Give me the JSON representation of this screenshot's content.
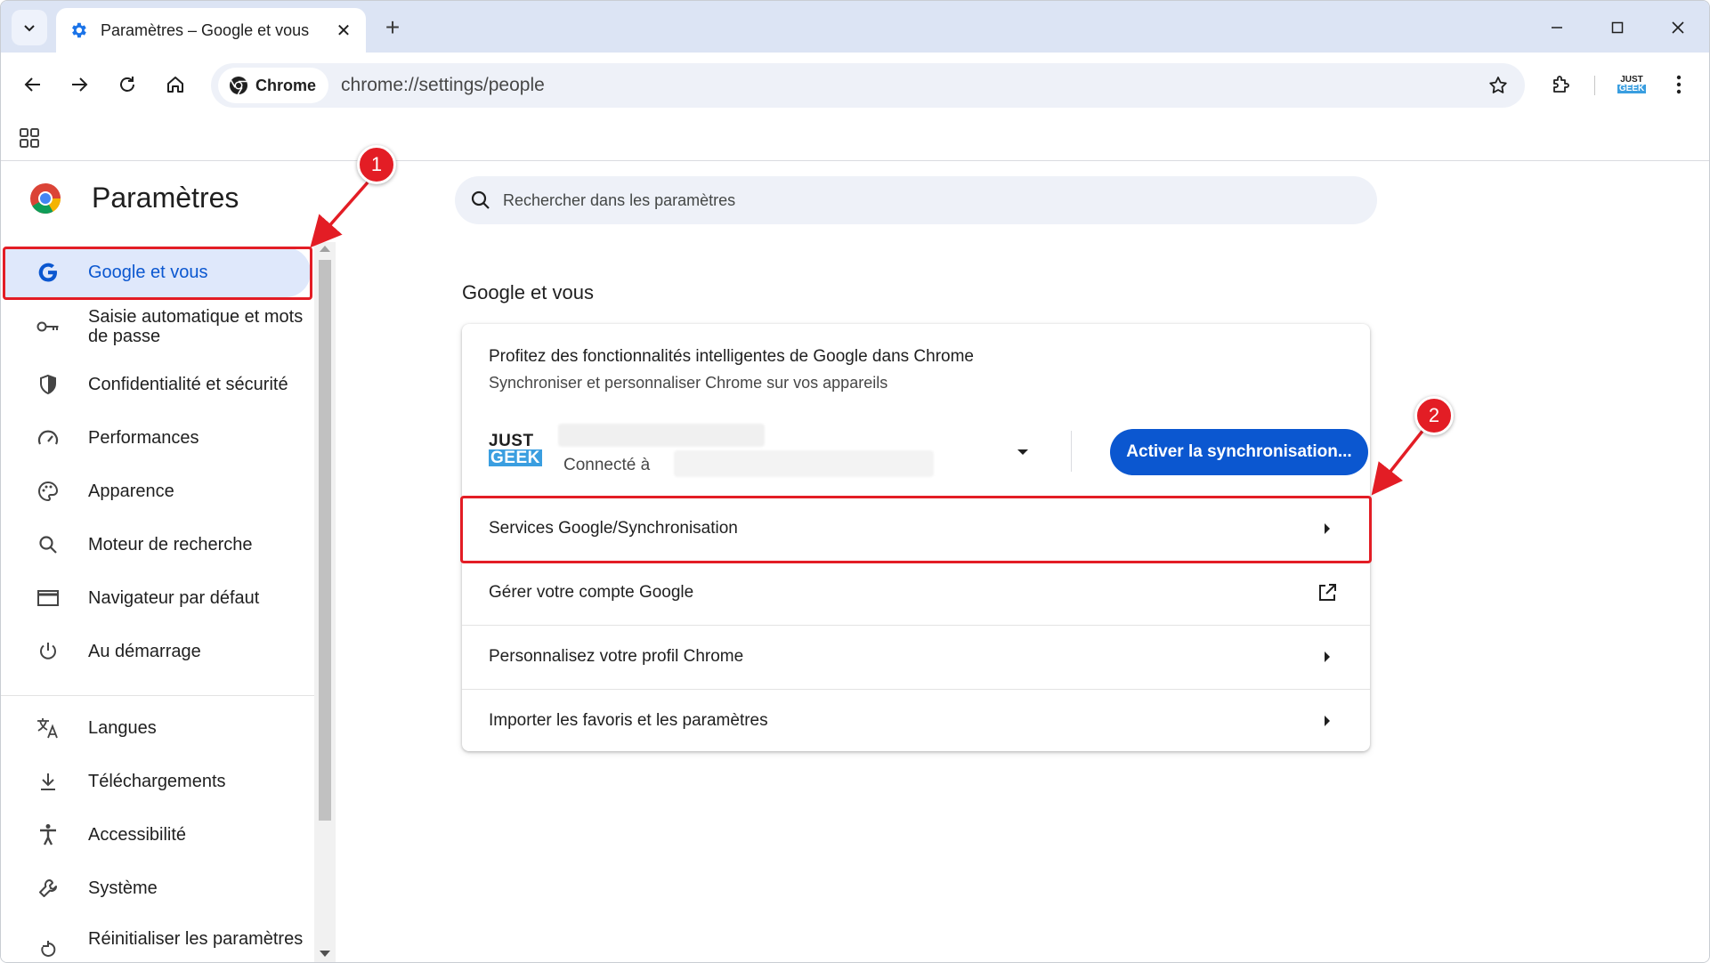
{
  "browser": {
    "tab": {
      "title": "Paramètres – Google et vous",
      "icon": "gear-icon"
    },
    "omnibox": {
      "chip_label": "Chrome",
      "url": "chrome://settings/people"
    },
    "profile": {
      "line1": "JUST",
      "line2": "GEEK"
    }
  },
  "settings": {
    "title": "Paramètres",
    "search": {
      "placeholder": "Rechercher dans les paramètres"
    },
    "sidebar": {
      "items": [
        {
          "label": "Google et vous",
          "icon": "google-g-icon",
          "active": true
        },
        {
          "label": "Saisie automatique et mots de passe",
          "icon": "key-icon"
        },
        {
          "label": "Confidentialité et sécurité",
          "icon": "shield-icon"
        },
        {
          "label": "Performances",
          "icon": "speedometer-icon"
        },
        {
          "label": "Apparence",
          "icon": "palette-icon"
        },
        {
          "label": "Moteur de recherche",
          "icon": "search-icon"
        },
        {
          "label": "Navigateur par défaut",
          "icon": "browser-window-icon"
        },
        {
          "label": "Au démarrage",
          "icon": "power-icon"
        },
        {
          "label": "Langues",
          "icon": "translate-icon"
        },
        {
          "label": "Téléchargements",
          "icon": "download-icon"
        },
        {
          "label": "Accessibilité",
          "icon": "accessibility-icon"
        },
        {
          "label": "Système",
          "icon": "wrench-icon"
        },
        {
          "label": "Réinitialiser les paramètres",
          "icon": "reset-icon"
        }
      ]
    },
    "section": {
      "title": "Google et vous",
      "promo_title": "Profitez des fonctionnalités intelligentes de Google dans Chrome",
      "promo_subtitle": "Synchroniser et personnaliser Chrome sur vos appareils",
      "account": {
        "logo_line1": "JUST",
        "logo_line2": "GEEK",
        "connected_label": "Connecté à"
      },
      "sync_button": "Activer la synchronisation...",
      "rows": [
        {
          "label": "Services Google/Synchronisation",
          "action": "chevron-right-icon"
        },
        {
          "label": "Gérer votre compte Google",
          "action": "external-link-icon"
        },
        {
          "label": "Personnalisez votre profil Chrome",
          "action": "chevron-right-icon"
        },
        {
          "label": "Importer les favoris et les paramètres",
          "action": "chevron-right-icon"
        }
      ]
    }
  },
  "annotations": {
    "badge_1": "1",
    "badge_2": "2"
  },
  "colors": {
    "accent": "#0b57d0",
    "active_nav_bg": "#dfe8fb",
    "annotation_red": "#e31d25"
  }
}
